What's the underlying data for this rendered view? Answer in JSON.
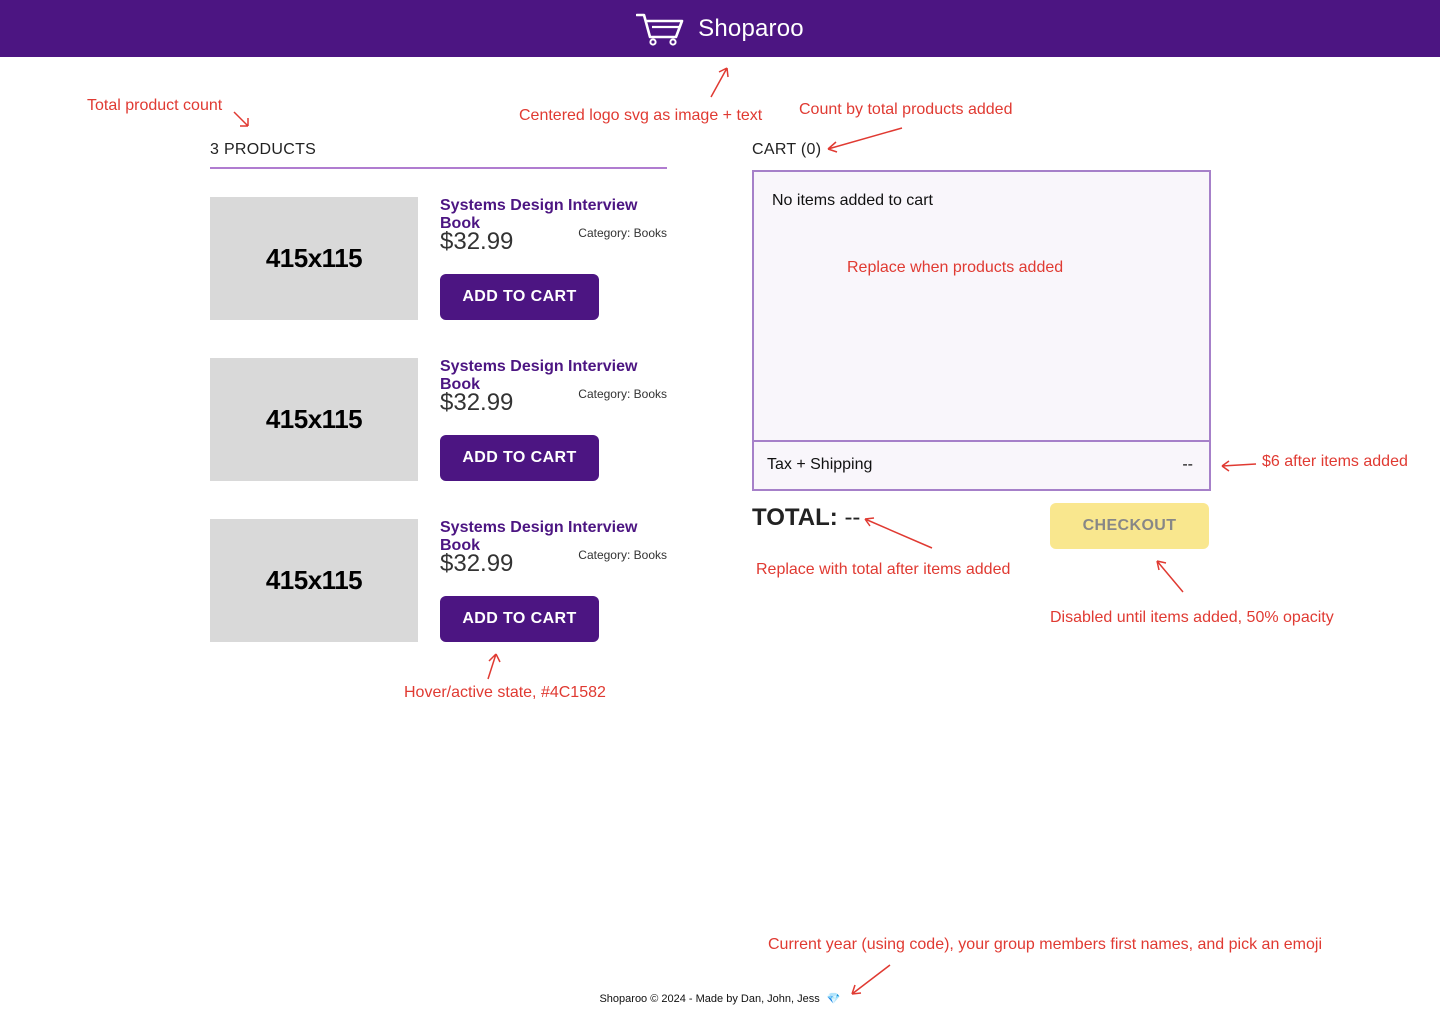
{
  "colors": {
    "brand": "#4C1582",
    "accent": "#f5d020",
    "annotation": "#e03a32"
  },
  "header": {
    "logo_icon": "shopping-cart-icon",
    "title": "Shoparoo"
  },
  "products_section": {
    "title": "3 PRODUCTS",
    "items": [
      {
        "image_placeholder": "415x115",
        "name": "Systems Design Interview Book",
        "price": "$32.99",
        "category": "Category: Books",
        "button_label": "ADD TO CART"
      },
      {
        "image_placeholder": "415x115",
        "name": "Systems Design Interview Book",
        "price": "$32.99",
        "category": "Category: Books",
        "button_label": "ADD TO CART"
      },
      {
        "image_placeholder": "415x115",
        "name": "Systems Design Interview Book",
        "price": "$32.99",
        "category": "Category: Books",
        "button_label": "ADD TO CART"
      }
    ]
  },
  "cart": {
    "title": "CART (0)",
    "empty_message": "No items added to cart",
    "tax_label": "Tax + Shipping",
    "tax_value": "--",
    "total_label": "TOTAL:",
    "total_value": "--",
    "checkout_label": "CHECKOUT",
    "checkout_disabled": true
  },
  "footer": {
    "text": "Shoparoo © 2024  -  Made by Dan, John, Jess",
    "emoji": "💎"
  },
  "annotations": {
    "total_count": "Total product count",
    "logo": "Centered logo svg as image + text",
    "cart_count": "Count by total products added",
    "replace_products": "Replace when products added",
    "tax": "$6 after items added",
    "total": "Replace with total after items added",
    "checkout": "Disabled until items added, 50% opacity",
    "hover": "Hover/active state,  #4C1582",
    "footer": "Current year (using code), your group members first names, and pick an emoji"
  }
}
